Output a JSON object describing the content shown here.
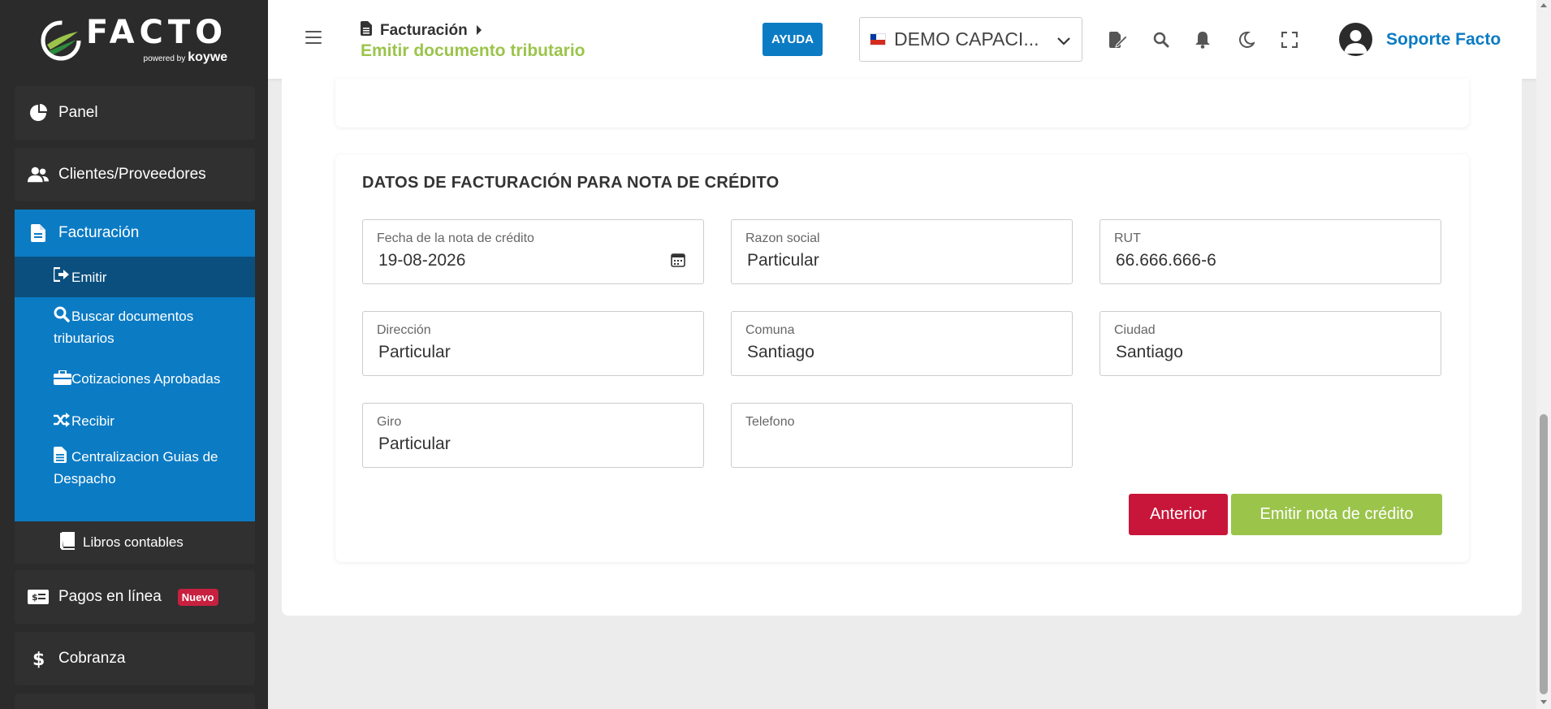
{
  "brand": {
    "name": "FACTO",
    "powered": "powered by",
    "partner": "koywe"
  },
  "sidebar": {
    "items": [
      {
        "label": "Panel",
        "icon": "pie-chart-icon"
      },
      {
        "label": "Clientes/Proveedores",
        "icon": "users-icon"
      },
      {
        "label": "Facturación",
        "icon": "document-icon"
      },
      {
        "label": "Pagos en línea",
        "icon": "money-bill-icon",
        "badge": "Nuevo"
      },
      {
        "label": "Cobranza",
        "icon": "dollar-icon"
      }
    ],
    "facturacion_sub": [
      {
        "label": "Emitir",
        "icon": "sign-out-icon"
      },
      {
        "label": "Buscar documentos tributarios",
        "icon": "search-icon"
      },
      {
        "label": "Cotizaciones Aprobadas",
        "icon": "briefcase-icon"
      },
      {
        "label": "Recibir",
        "icon": "shuffle-icon"
      },
      {
        "label": "Centralizacion Guias de Despacho",
        "icon": "file-text-icon"
      },
      {
        "label": "Libros contables",
        "icon": "book-icon"
      }
    ]
  },
  "header": {
    "breadcrumb": "Facturación",
    "page_title": "Emitir documento tributario",
    "help_label": "AYUDA",
    "company": "DEMO CAPACI...",
    "user_name": "Soporte Facto"
  },
  "form": {
    "title": "DATOS DE FACTURACIÓN PARA NOTA DE CRÉDITO",
    "fields": [
      {
        "label": "Fecha de la nota de crédito",
        "value": "19-08-2026"
      },
      {
        "label": "Razon social",
        "value": "Particular"
      },
      {
        "label": "RUT",
        "value": "66.666.666-6"
      },
      {
        "label": "Dirección",
        "value": "Particular"
      },
      {
        "label": "Comuna",
        "value": "Santiago"
      },
      {
        "label": "Ciudad",
        "value": "Santiago"
      },
      {
        "label": "Giro",
        "value": "Particular"
      },
      {
        "label": "Telefono",
        "value": ""
      }
    ],
    "btn_prev": "Anterior",
    "btn_submit": "Emitir nota de crédito"
  },
  "colors": {
    "primary": "#0b7bc4",
    "accent_green": "#9bc44b",
    "danger": "#c8163a",
    "sidebar_bg": "#2b2b2b"
  }
}
